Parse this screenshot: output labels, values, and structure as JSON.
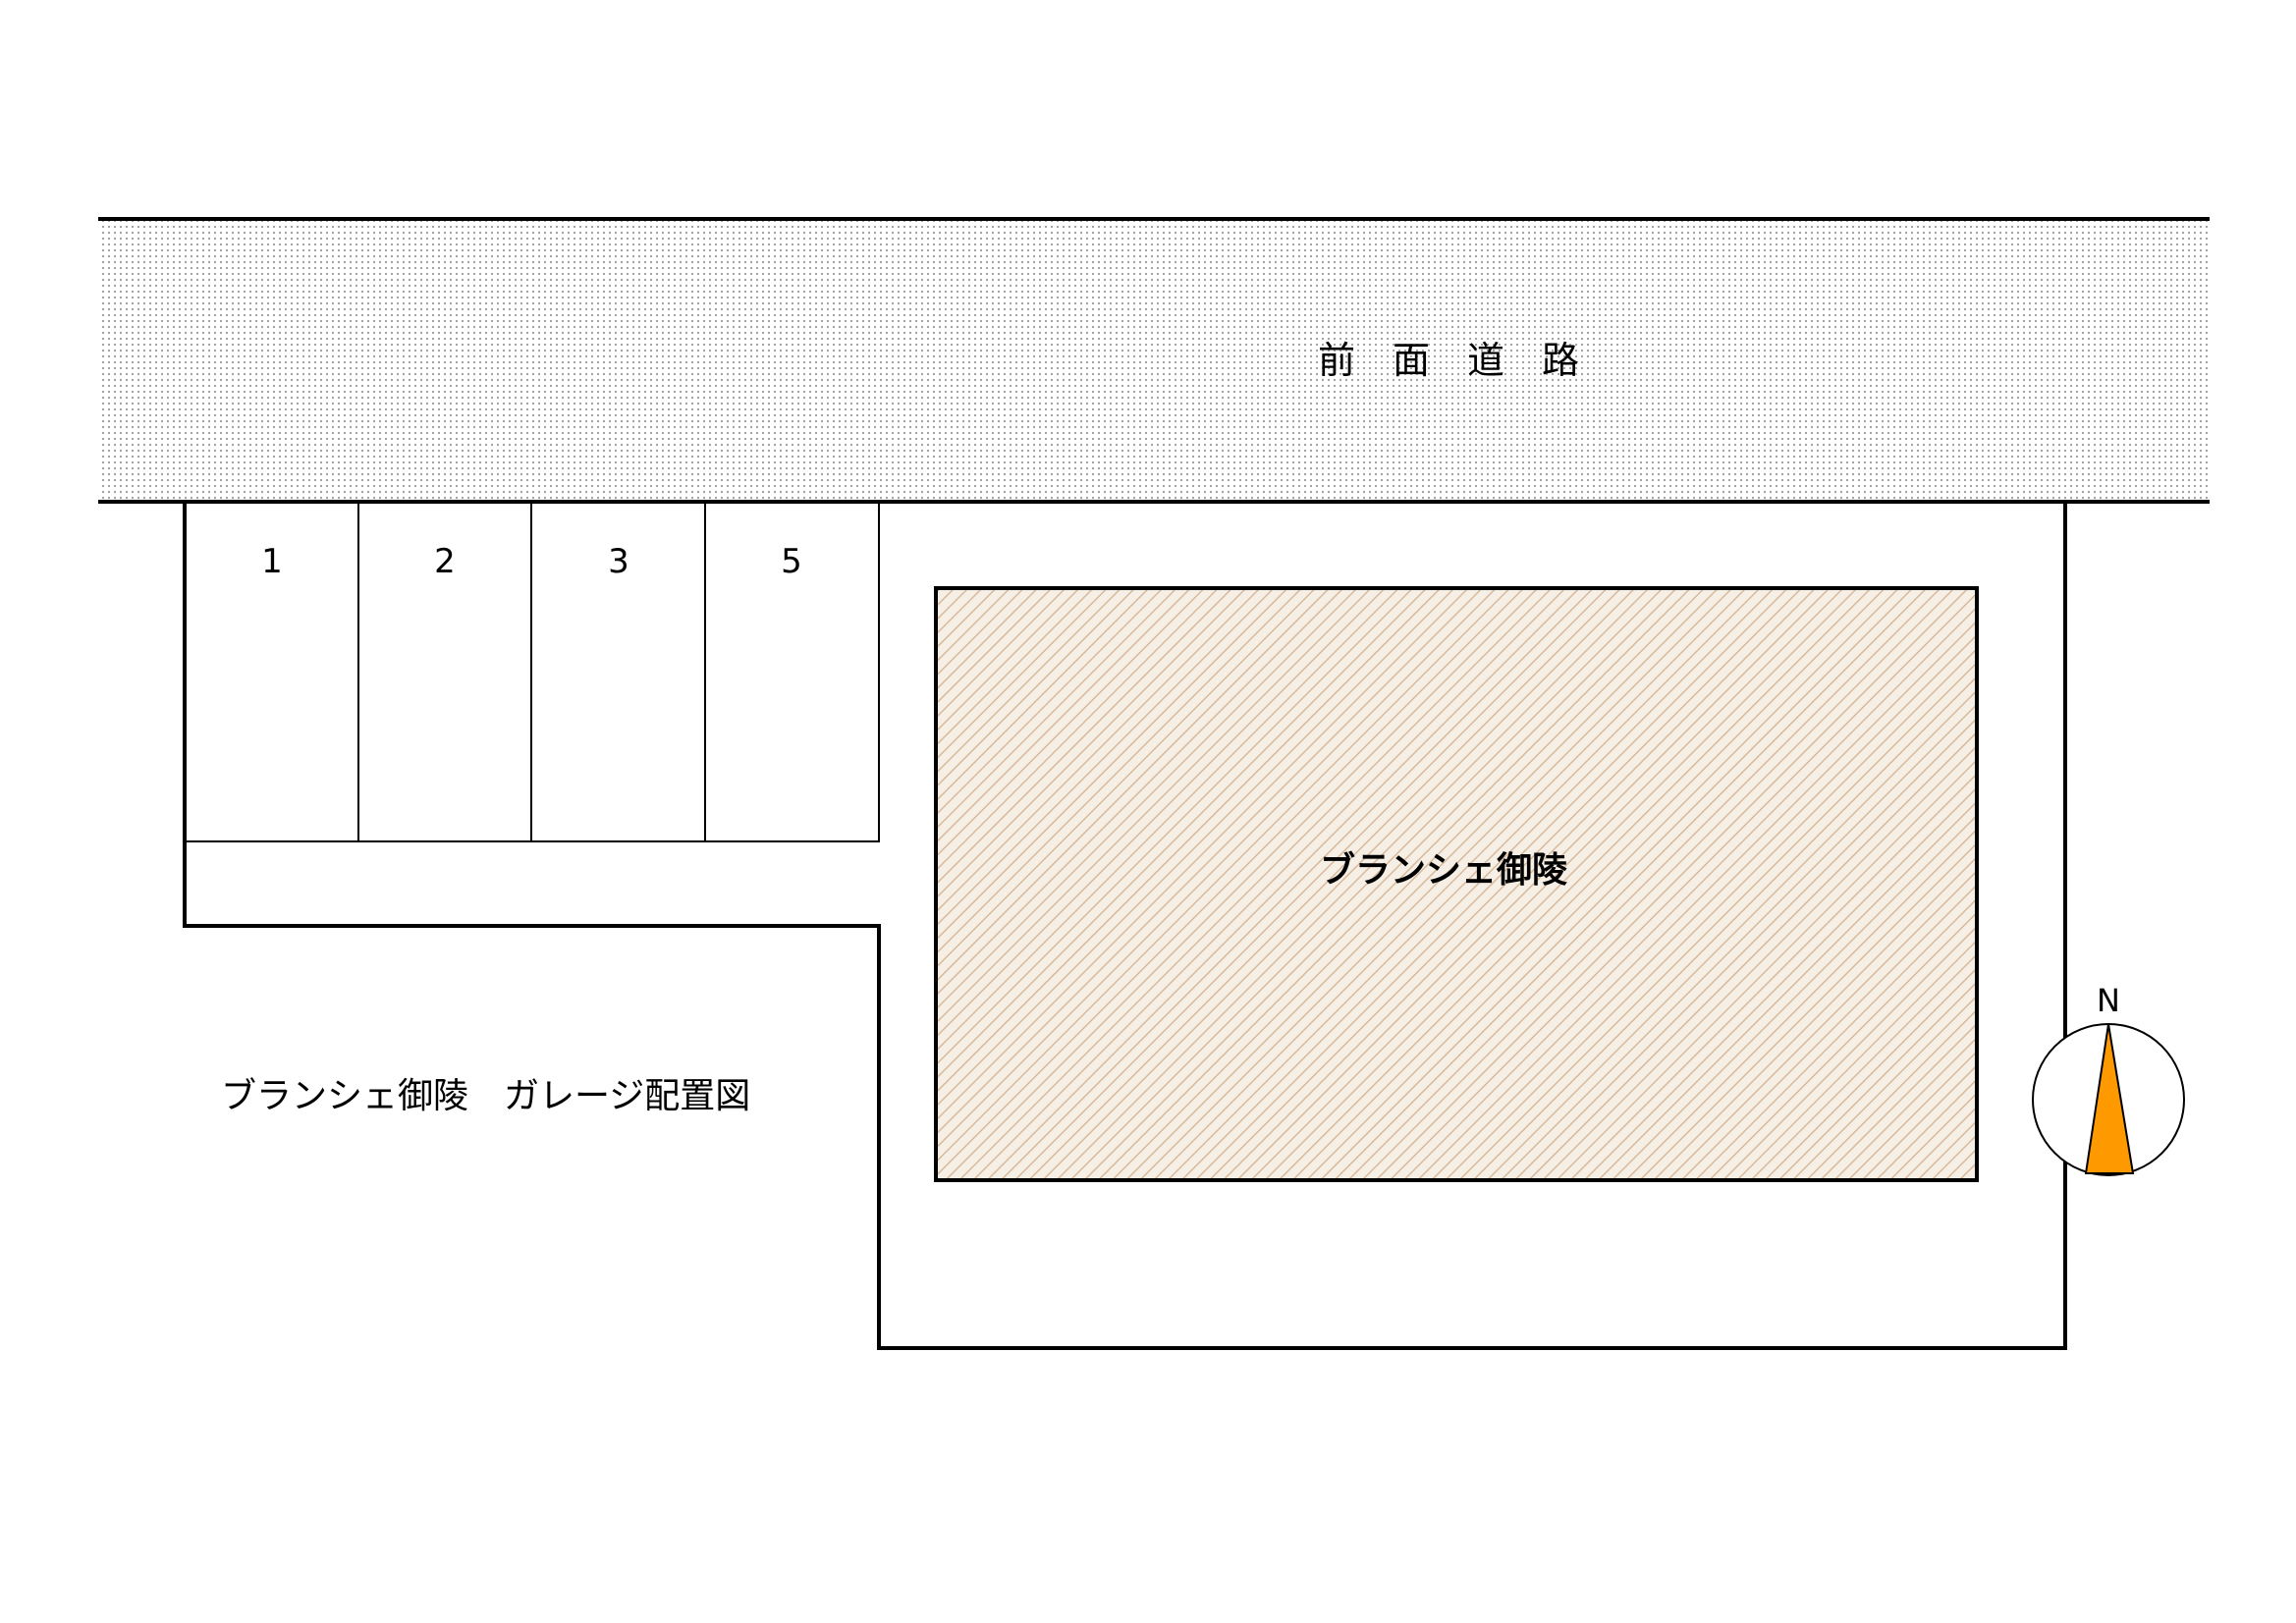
{
  "road": {
    "label": "前　面　道　路"
  },
  "building": {
    "label": "ブランシェ御陵"
  },
  "parking": {
    "spaces": [
      {
        "number": "1"
      },
      {
        "number": "2"
      },
      {
        "number": "3"
      },
      {
        "number": "5"
      }
    ]
  },
  "diagram": {
    "title": "ブランシェ御陵　ガレージ配置図"
  },
  "compass": {
    "north_label": "N"
  },
  "colors": {
    "road_dots": "#9a9a9a",
    "building_fill": "#f6efe6",
    "building_hatch": "#d9b99a",
    "compass_needle": "#ff9900",
    "line": "#000000"
  }
}
